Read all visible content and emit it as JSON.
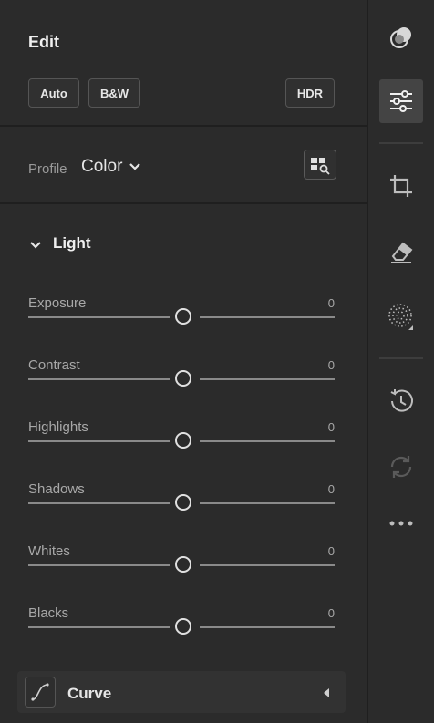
{
  "edit": {
    "title": "Edit",
    "buttons": {
      "auto": "Auto",
      "bw": "B&W",
      "hdr": "HDR"
    }
  },
  "profile": {
    "label": "Profile",
    "value": "Color"
  },
  "light": {
    "title": "Light",
    "sliders": [
      {
        "label": "Exposure",
        "value": "0"
      },
      {
        "label": "Contrast",
        "value": "0"
      },
      {
        "label": "Highlights",
        "value": "0"
      },
      {
        "label": "Shadows",
        "value": "0"
      },
      {
        "label": "Whites",
        "value": "0"
      },
      {
        "label": "Blacks",
        "value": "0"
      }
    ]
  },
  "curve": {
    "title": "Curve"
  },
  "rail": {
    "icons": [
      "mask-icon",
      "sliders-icon",
      "crop-icon",
      "eraser-icon",
      "vignette-icon",
      "history-icon",
      "sync-icon",
      "more-icon"
    ]
  }
}
